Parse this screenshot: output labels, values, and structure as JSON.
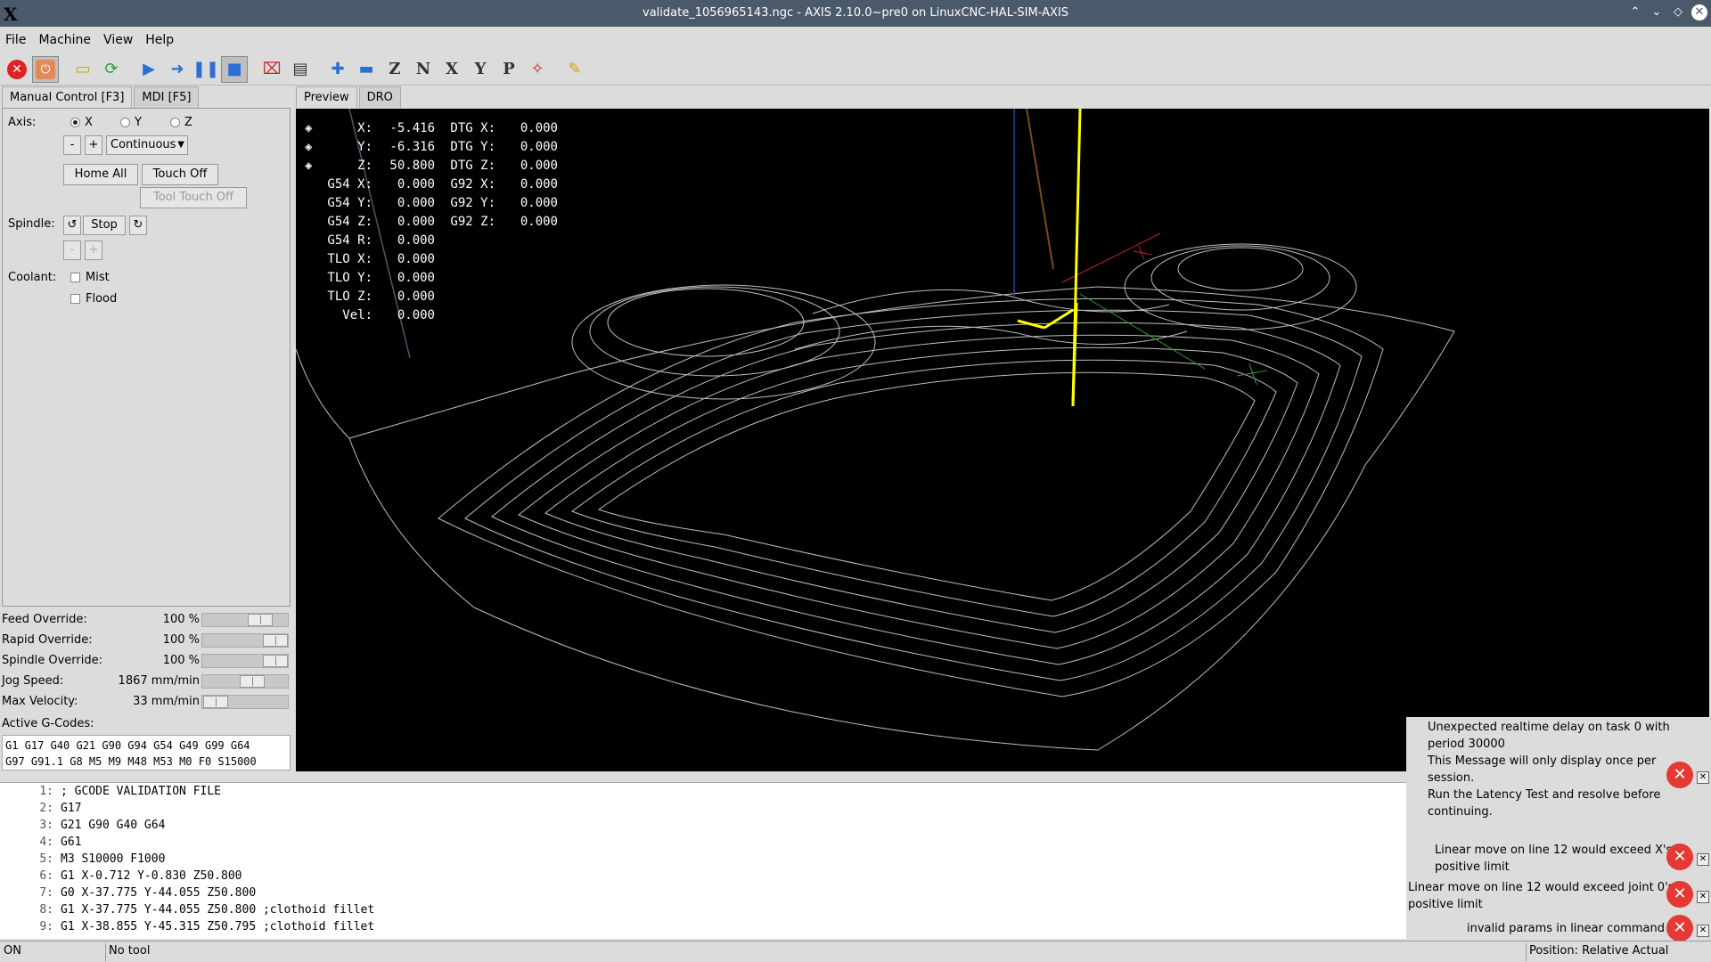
{
  "window": {
    "title": "validate_1056965143.ngc - AXIS 2.10.0~pre0 on LinuxCNC-HAL-SIM-AXIS",
    "logo": "X"
  },
  "menu": [
    "File",
    "Machine",
    "View",
    "Help"
  ],
  "left_tabs": [
    "Manual Control [F3]",
    "MDI [F5]"
  ],
  "manual": {
    "axis_label": "Axis:",
    "axes": [
      "X",
      "Y",
      "Z"
    ],
    "selected_axis": "X",
    "jog_minus": "-",
    "jog_plus": "+",
    "jog_mode": "Continuous",
    "home_all": "Home All",
    "touch_off": "Touch Off",
    "tool_touch_off": "Tool Touch Off",
    "spindle_label": "Spindle:",
    "spindle_stop": "Stop",
    "spindle_minus": "-",
    "spindle_plus": "+",
    "coolant_label": "Coolant:",
    "mist": "Mist",
    "flood": "Flood"
  },
  "overrides": [
    {
      "label": "Feed Override:",
      "value": "100 %",
      "level": 0.75
    },
    {
      "label": "Rapid Override:",
      "value": "100 %",
      "level": 1.0
    },
    {
      "label": "Spindle Override:",
      "value": "100 %",
      "level": 1.0
    },
    {
      "label": "Jog Speed:",
      "value": "1867 mm/min",
      "level": 0.62
    },
    {
      "label": "Max Velocity:",
      "value": "33 mm/min",
      "level": 0.02
    }
  ],
  "active_gcodes_label": "Active G-Codes:",
  "active_gcodes": "G1 G17 G40 G21 G90 G94 G54 G49 G99 G64\nG97 G91.1 G8 M5 M9 M48 M53 M0 F0 S15000",
  "preview_tabs": [
    "Preview",
    "DRO"
  ],
  "dro": [
    {
      "marker": "◈",
      "label": "X:",
      "value": "-5.416",
      "dtg_label": "DTG X:",
      "dtg": "0.000"
    },
    {
      "marker": "◈",
      "label": "Y:",
      "value": "-6.316",
      "dtg_label": "DTG Y:",
      "dtg": "0.000"
    },
    {
      "marker": "◈",
      "label": "Z:",
      "value": "50.800",
      "dtg_label": "DTG Z:",
      "dtg": "0.000"
    },
    {
      "marker": "",
      "label": "G54 X:",
      "value": "0.000",
      "dtg_label": "G92 X:",
      "dtg": "0.000"
    },
    {
      "marker": "",
      "label": "G54 Y:",
      "value": "0.000",
      "dtg_label": "G92 Y:",
      "dtg": "0.000"
    },
    {
      "marker": "",
      "label": "G54 Z:",
      "value": "0.000",
      "dtg_label": "G92 Z:",
      "dtg": "0.000"
    },
    {
      "marker": "",
      "label": "G54 R:",
      "value": "0.000",
      "dtg_label": "",
      "dtg": ""
    },
    {
      "marker": "",
      "label": "TLO X:",
      "value": "0.000",
      "dtg_label": "",
      "dtg": ""
    },
    {
      "marker": "",
      "label": "TLO Y:",
      "value": "0.000",
      "dtg_label": "",
      "dtg": ""
    },
    {
      "marker": "",
      "label": "TLO Z:",
      "value": "0.000",
      "dtg_label": "",
      "dtg": ""
    },
    {
      "marker": "",
      "label": "Vel:",
      "value": "0.000",
      "dtg_label": "",
      "dtg": ""
    }
  ],
  "code": [
    {
      "n": "1:",
      "text": "; GCODE VALIDATION FILE"
    },
    {
      "n": "2:",
      "text": "G17"
    },
    {
      "n": "3:",
      "text": "G21 G90 G40 G64"
    },
    {
      "n": "4:",
      "text": "G61"
    },
    {
      "n": "5:",
      "text": "M3 S10000 F1000"
    },
    {
      "n": "6:",
      "text": "G1 X-0.712 Y-0.830 Z50.800"
    },
    {
      "n": "7:",
      "text": "G0 X-37.775 Y-44.055 Z50.800"
    },
    {
      "n": "8:",
      "text": "G1 X-37.775 Y-44.055 Z50.800 ;clothoid fillet"
    },
    {
      "n": "9:",
      "text": "G1 X-38.855 Y-45.315 Z50.795 ;clothoid fillet"
    }
  ],
  "notifications": {
    "n1_line1": "Unexpected realtime delay on task 0 with",
    "n1_line2": "period 30000",
    "n1_line3": "This Message will only display once per",
    "n1_line4": "session.",
    "n1_line5": "Run the Latency Test and resolve before",
    "n1_line6": "continuing.",
    "n2_line1": "Linear move on line 12 would exceed X's",
    "n2_line2": "positive limit",
    "n3_line1": "Linear move on line 12 would exceed joint 0's",
    "n3_line2": "positive limit",
    "n4_line1": "invalid params in linear command",
    "icon": "✕",
    "close": "✕"
  },
  "status": {
    "state": "ON",
    "tool": "No tool",
    "position": "Position: Relative Actual"
  },
  "colors": {
    "preview_bg": "#000000",
    "toolpath": "#bfbfbf",
    "tool": "#ffff00",
    "error": "#e53935"
  }
}
